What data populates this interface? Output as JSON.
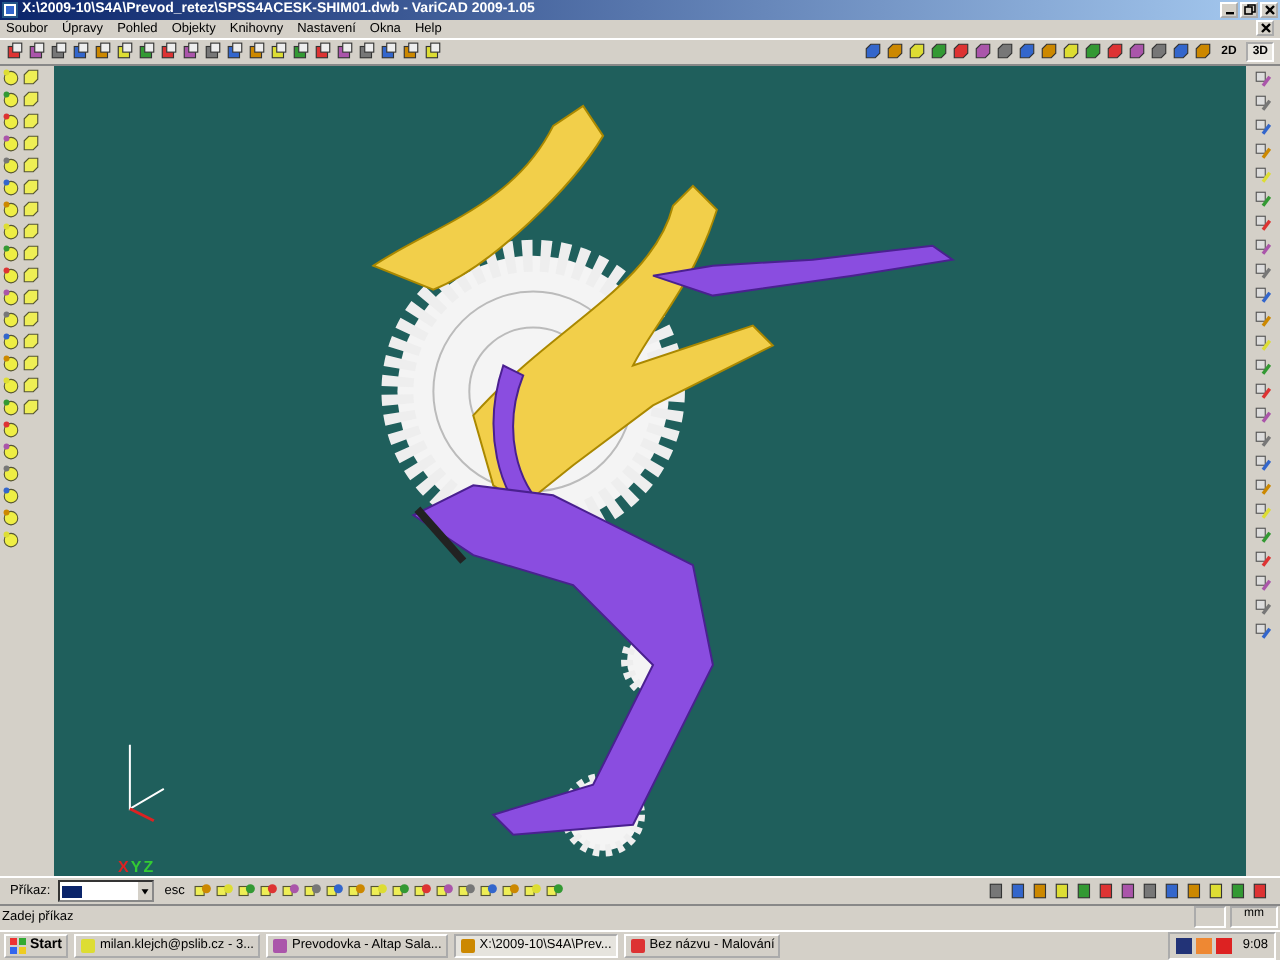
{
  "window": {
    "title": "X:\\2009-10\\S4A\\Prevod_retez\\SPSS4ACESK-SHIM01.dwb - VariCAD 2009-1.05"
  },
  "menu": [
    "Soubor",
    "Úpravy",
    "Pohled",
    "Objekty",
    "Knihovny",
    "Nastavení",
    "Okna",
    "Help"
  ],
  "view_buttons": [
    {
      "label": "2D",
      "selected": false
    },
    {
      "label": "3D",
      "selected": true
    }
  ],
  "axes": {
    "x": "X",
    "y": "Y",
    "z": "Z"
  },
  "command_bar": {
    "label": "Příkaz:",
    "escape": "esc"
  },
  "status_bar": {
    "prompt": "Zadej příkaz",
    "units": "mm"
  },
  "taskbar": {
    "start": "Start",
    "tasks": [
      {
        "label": "milan.klejch@pslib.cz - 3...",
        "selected": false
      },
      {
        "label": "Prevodovka - Altap Sala...",
        "selected": false
      },
      {
        "label": "X:\\2009-10\\S4A\\Prev...",
        "selected": true
      },
      {
        "label": "Bez názvu - Malování",
        "selected": false
      }
    ],
    "clock": "9:08"
  }
}
